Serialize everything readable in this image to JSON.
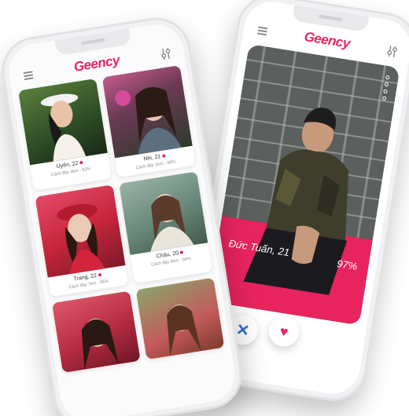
{
  "app": {
    "brand": "Geency"
  },
  "colors": {
    "brand": "#e8245e",
    "dislike": "#2f6fd6"
  },
  "swipe_screen": {
    "profile_name": "Đức Tuấn, 21",
    "match_percent": "97%",
    "icons": [
      "menu-icon",
      "filter-icon",
      "close-icon",
      "heart-icon"
    ]
  },
  "browse_screen": {
    "cards": [
      {
        "name": "Uyên, 22",
        "distance": "Cách đây 4km - 92%"
      },
      {
        "name": "Nhi, 21",
        "distance": "Cách đây 1km - 96%"
      },
      {
        "name": "Trang, 22",
        "distance": "Cách đây 7km - 95%"
      },
      {
        "name": "Châu, 20",
        "distance": "Cách đây 8km - 98%"
      },
      {
        "name": "",
        "distance": ""
      },
      {
        "name": "",
        "distance": ""
      }
    ]
  }
}
